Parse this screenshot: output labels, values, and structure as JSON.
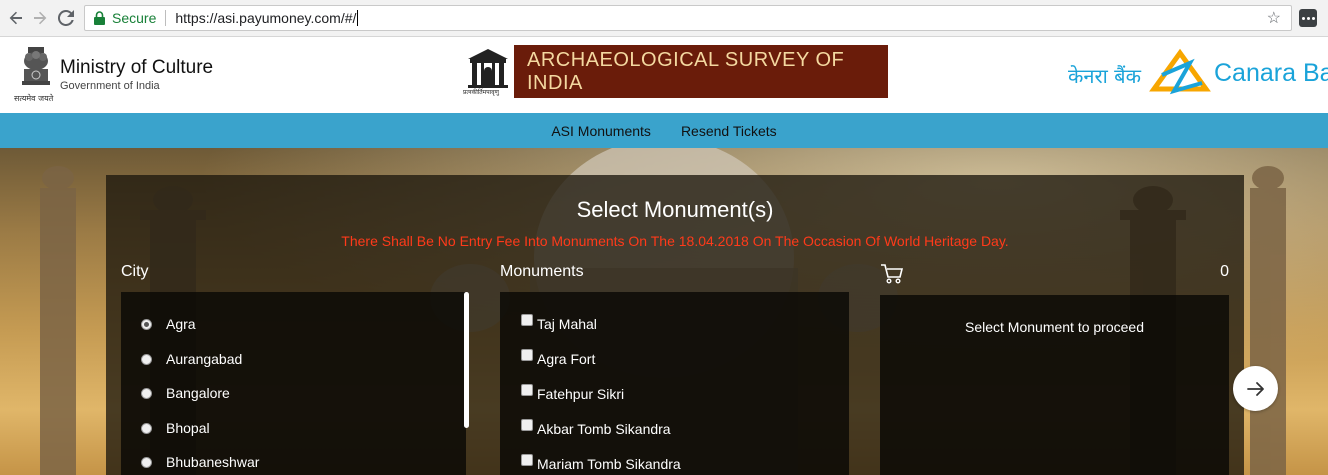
{
  "browser": {
    "secure_label": "Secure",
    "url": "https://asi.payumoney.com/#/"
  },
  "header": {
    "ministry_title": "Ministry of Culture",
    "ministry_sub": "Government of India",
    "emblem_motto": "सत्यमेव जयते",
    "asi_title": "ARCHAEOLOGICAL SURVEY OF INDIA",
    "asi_motto": "प्रत्नकीर्तिमपावृणु",
    "canara_hindi": "केनरा बैंक",
    "canara_english": "Canara Bank"
  },
  "nav": {
    "items": [
      {
        "label": "ASI Monuments"
      },
      {
        "label": "Resend Tickets"
      }
    ]
  },
  "panel": {
    "title": "Select Monument(s)",
    "notice": "There Shall Be No Entry Fee Into Monuments On The 18.04.2018 On The Occasion Of World Heritage Day.",
    "city_heading": "City",
    "monuments_heading": "Monuments",
    "cart_count": "0",
    "cart_message": "Select Monument to proceed",
    "cities": [
      {
        "label": "Agra",
        "selected": true
      },
      {
        "label": "Aurangabad",
        "selected": false
      },
      {
        "label": "Bangalore",
        "selected": false
      },
      {
        "label": "Bhopal",
        "selected": false
      },
      {
        "label": "Bhubaneshwar",
        "selected": false
      }
    ],
    "monuments": [
      {
        "label": "Taj Mahal",
        "checked": false
      },
      {
        "label": "Agra Fort",
        "checked": false
      },
      {
        "label": "Fatehpur Sikri",
        "checked": false
      },
      {
        "label": "Akbar Tomb Sikandra",
        "checked": false
      },
      {
        "label": "Mariam Tomb Sikandra",
        "checked": false
      }
    ]
  },
  "icons": {
    "back": "arrow-left-icon",
    "forward": "arrow-right-icon",
    "reload": "reload-icon",
    "lock": "lock-icon",
    "bookmark": "star-icon",
    "extension": "extension-icon",
    "cart": "cart-icon",
    "next": "arrow-right-icon"
  },
  "colors": {
    "navbar": "#3aa3cc",
    "notice": "#ff3a1a",
    "asi_banner": "#6a1c0a",
    "canara": "#1aa3d9",
    "secure": "#188038"
  }
}
